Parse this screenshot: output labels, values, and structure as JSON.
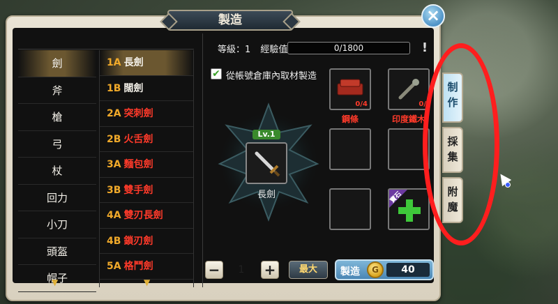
{
  "title": "製造",
  "categories": [
    "劍",
    "斧",
    "槍",
    "弓",
    "杖",
    "回力",
    "小刀",
    "頭盔",
    "帽子"
  ],
  "active_category": 0,
  "items": [
    {
      "code": "1A",
      "name": "長劍",
      "red": false
    },
    {
      "code": "1B",
      "name": "闊劍",
      "red": false
    },
    {
      "code": "2A",
      "name": "突刺劍",
      "red": true
    },
    {
      "code": "2B",
      "name": "火舌劍",
      "red": true
    },
    {
      "code": "3A",
      "name": "麵包劍",
      "red": true
    },
    {
      "code": "3B",
      "name": "雙手劍",
      "red": true
    },
    {
      "code": "4A",
      "name": "雙刃長劍",
      "red": true
    },
    {
      "code": "4B",
      "name": "鎖刃劍",
      "red": true
    },
    {
      "code": "5A",
      "name": "格鬥劍",
      "red": true
    }
  ],
  "active_item": 0,
  "detail": {
    "level_label": "等級：1",
    "exp_label": "經驗值",
    "exp_value": "0/1800",
    "warning_icon": "!",
    "checkbox_label": "從帳號倉庫內取材製造",
    "checkbox_checked": true,
    "lv_badge": "Lv.1",
    "item_name": "長劍",
    "materials": [
      {
        "name": "鋼條",
        "count": "0/4"
      },
      {
        "name": "印度鐵木",
        "count": "0/"
      }
    ],
    "gem_tag": "寶石"
  },
  "controls": {
    "minus": "−",
    "qty": "1",
    "plus": "+",
    "max_label": "最大",
    "craft_label": "製造",
    "coin_icon": "G",
    "cost": "40"
  },
  "side_tabs": [
    {
      "label": "制\n作",
      "active": true
    },
    {
      "label": "採\n集",
      "active": false
    },
    {
      "label": "附\n魔",
      "active": false
    }
  ],
  "close_icon": "×"
}
